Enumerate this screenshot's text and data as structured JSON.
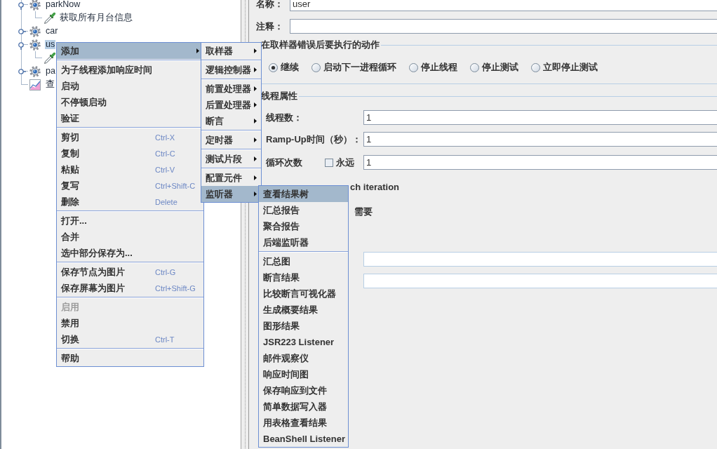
{
  "tree": {
    "items": [
      {
        "kind": "thread-group",
        "label": "parkNow",
        "expanded": true,
        "selected": false,
        "children": [
          {
            "kind": "sampler",
            "label": "获取所有月台信息",
            "selected": false
          }
        ]
      },
      {
        "kind": "thread-group",
        "label": "car",
        "expanded": false,
        "selected": false
      },
      {
        "kind": "thread-group",
        "label": "us",
        "expanded": true,
        "selected": true,
        "children": [
          {
            "kind": "sampler"
          }
        ]
      },
      {
        "kind": "thread-group",
        "label": "pa",
        "expanded": false,
        "selected": false
      },
      {
        "kind": "listener",
        "label": "查",
        "selected": false
      }
    ]
  },
  "name_field": {
    "label": "名称：",
    "value": "user"
  },
  "comment_field": {
    "label": "注释："
  },
  "error_action_group": {
    "title": "在取样器错误后要执行的动作",
    "options": [
      {
        "label": "继续",
        "selected": true
      },
      {
        "label": "启动下一进程循环",
        "selected": false
      },
      {
        "label": "停止线程",
        "selected": false
      },
      {
        "label": "停止测试",
        "selected": false
      },
      {
        "label": "立即停止测试",
        "selected": false
      }
    ]
  },
  "thread_properties_group": {
    "title": "线程属性",
    "fields": [
      {
        "kind": "text",
        "label": "线程数：",
        "value": "1"
      },
      {
        "kind": "text",
        "label": "Ramp-Up时间（秒）：",
        "value": "1"
      },
      {
        "kind": "loop",
        "label": "循环次数",
        "value": "1",
        "checkbox": {
          "label": "永远",
          "checked": false
        }
      }
    ],
    "option_labels": [
      "ch iteration",
      "需要"
    ],
    "blank_fields": [
      {
        "disabled": true
      },
      {
        "disabled": true
      }
    ]
  },
  "context_menu": {
    "groups": [
      {
        "items": [
          {
            "label": "添加",
            "submenu": true,
            "selected": true,
            "disabled": false
          }
        ]
      },
      {
        "items": [
          {
            "label": "为子线程添加响应时间",
            "submenu": false,
            "selected": false,
            "disabled": false
          },
          {
            "label": "启动",
            "submenu": false,
            "selected": false,
            "disabled": false
          },
          {
            "label": "不停顿启动",
            "submenu": false,
            "selected": false,
            "disabled": false
          },
          {
            "label": "验证",
            "submenu": false,
            "selected": false,
            "disabled": false
          }
        ]
      },
      {
        "items": [
          {
            "label": "剪切",
            "shortcut": "Ctrl-X",
            "submenu": false,
            "selected": false,
            "disabled": false
          },
          {
            "label": "复制",
            "shortcut": "Ctrl-C",
            "submenu": false,
            "selected": false,
            "disabled": false
          },
          {
            "label": "粘贴",
            "shortcut": "Ctrl-V",
            "submenu": false,
            "selected": false,
            "disabled": false
          },
          {
            "label": "复写",
            "shortcut": "Ctrl+Shift-C",
            "submenu": false,
            "selected": false,
            "disabled": false
          },
          {
            "label": "删除",
            "shortcut": "Delete",
            "submenu": false,
            "selected": false,
            "disabled": false
          }
        ]
      },
      {
        "items": [
          {
            "label": "打开...",
            "submenu": false,
            "selected": false,
            "disabled": false
          },
          {
            "label": "合并",
            "submenu": false,
            "selected": false,
            "disabled": false
          },
          {
            "label": "选中部分保存为...",
            "submenu": false,
            "selected": false,
            "disabled": false
          }
        ]
      },
      {
        "items": [
          {
            "label": "保存节点为图片",
            "shortcut": "Ctrl-G",
            "submenu": false,
            "selected": false,
            "disabled": false
          },
          {
            "label": "保存屏幕为图片",
            "shortcut": "Ctrl+Shift-G",
            "submenu": false,
            "selected": false,
            "disabled": false
          }
        ]
      },
      {
        "items": [
          {
            "label": "启用",
            "submenu": false,
            "selected": false,
            "disabled": true
          },
          {
            "label": "禁用",
            "submenu": false,
            "selected": false,
            "disabled": false
          },
          {
            "label": "切换",
            "shortcut": "Ctrl-T",
            "submenu": false,
            "selected": false,
            "disabled": false
          }
        ]
      },
      {
        "items": [
          {
            "label": "帮助",
            "submenu": false,
            "selected": false,
            "disabled": false
          }
        ]
      }
    ]
  },
  "add_submenu": {
    "groups": [
      {
        "items": [
          {
            "label": "取样器",
            "submenu": true,
            "selected": false
          }
        ]
      },
      {
        "items": [
          {
            "label": "逻辑控制器",
            "submenu": true,
            "selected": false
          }
        ]
      },
      {
        "items": [
          {
            "label": "前置处理器",
            "submenu": true,
            "selected": false
          },
          {
            "label": "后置处理器",
            "submenu": true,
            "selected": false
          },
          {
            "label": "断言",
            "submenu": true,
            "selected": false
          }
        ]
      },
      {
        "items": [
          {
            "label": "定时器",
            "submenu": true,
            "selected": false
          }
        ]
      },
      {
        "items": [
          {
            "label": "测试片段",
            "submenu": true,
            "selected": false
          }
        ]
      },
      {
        "items": [
          {
            "label": "配置元件",
            "submenu": true,
            "selected": false
          },
          {
            "label": "监听器",
            "submenu": true,
            "selected": true
          }
        ]
      }
    ]
  },
  "listener_submenu": {
    "groups": [
      {
        "items": [
          {
            "label": "查看结果树",
            "selected": true
          },
          {
            "label": "汇总报告",
            "selected": false
          },
          {
            "label": "聚合报告",
            "selected": false
          },
          {
            "label": "后端监听器",
            "selected": false
          }
        ]
      },
      {
        "items": [
          {
            "label": "汇总图",
            "selected": false
          },
          {
            "label": "断言结果",
            "selected": false
          },
          {
            "label": "比较断言可视化器",
            "selected": false
          },
          {
            "label": "生成概要结果",
            "selected": false
          },
          {
            "label": "图形结果",
            "selected": false
          },
          {
            "label": "JSR223 Listener",
            "selected": false
          },
          {
            "label": "邮件观察仪",
            "selected": false
          },
          {
            "label": "响应时间图",
            "selected": false
          },
          {
            "label": "保存响应到文件",
            "selected": false
          },
          {
            "label": "简单数据写入器",
            "selected": false
          },
          {
            "label": "用表格查看结果",
            "selected": false
          },
          {
            "label": "BeanShell Listener",
            "selected": false
          }
        ]
      }
    ]
  }
}
